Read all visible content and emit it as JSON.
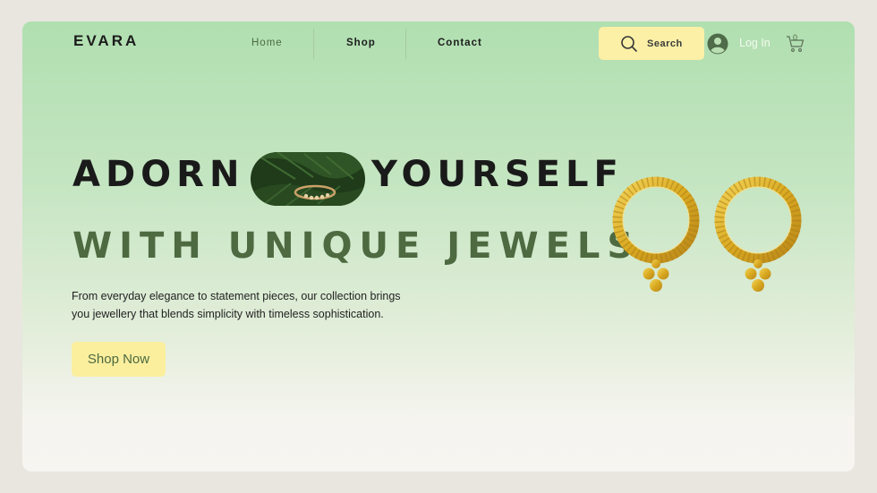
{
  "brand": {
    "logo_text": "EVARA"
  },
  "nav": {
    "items": [
      {
        "label": "Home"
      },
      {
        "label": "Shop"
      },
      {
        "label": "Contact"
      }
    ]
  },
  "header_actions": {
    "search_label": "Search",
    "login_label": "Log In",
    "cart_count": "0"
  },
  "hero": {
    "line1_left": "ADORN",
    "line1_right": "YOURSELF",
    "line2": "WITH UNIQUE JEWELS",
    "description_line1": "From everyday elegance to statement pieces, our collection brings",
    "description_line2": "you jewellery that blends simplicity with timeless sophistication.",
    "cta_label": "Shop Now"
  },
  "colors": {
    "accent_yellow": "#fbef9e",
    "brand_green": "#4d6a40",
    "gold": "#d9a920"
  }
}
